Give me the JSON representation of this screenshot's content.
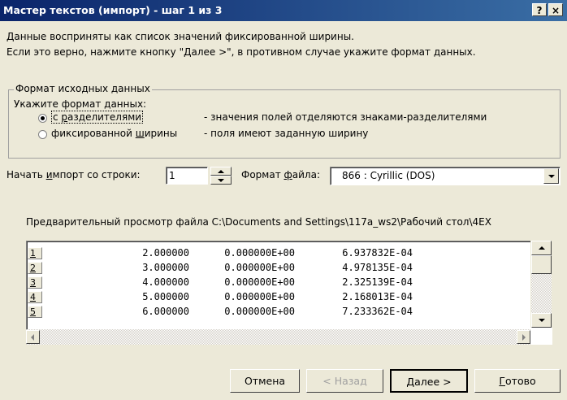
{
  "window": {
    "title": "Мастер текстов (импорт) - шаг 1 из 3",
    "help_label": "?",
    "close_label": "×"
  },
  "intro": {
    "line1": "Данные восприняты как список значений фиксированной ширины.",
    "line2": "Если это верно, нажмите кнопку \"Далее >\", в противном случае укажите формат данных."
  },
  "format_group": {
    "legend": "Формат исходных данных",
    "prompt": "Укажите формат данных:",
    "options": [
      {
        "pre": "с ",
        "key": "р",
        "post": "азделителями",
        "description": "- значения полей отделяются знаками-разделителями",
        "selected": true
      },
      {
        "pre": "фиксированной ",
        "key": "ш",
        "post": "ирины",
        "description": "- поля имеют заданную ширину",
        "selected": false
      }
    ]
  },
  "start_row": {
    "label_pre": "Начать ",
    "label_key": "и",
    "label_post": "мпорт со строки:",
    "value": "1"
  },
  "file_format": {
    "label_pre": "Формат ",
    "label_key": "ф",
    "label_post": "айла:",
    "value": "866 : Cyrillic (DOS)"
  },
  "preview": {
    "caption": "Предварительный просмотр файла C:\\Documents and Settings\\117a_ws2\\Рабочий стол\\4EX",
    "rows": [
      {
        "num": "1",
        "c1": "2.000000",
        "c2": "0.000000E+00",
        "c3": "6.937832E-04"
      },
      {
        "num": "2",
        "c1": "3.000000",
        "c2": "0.000000E+00",
        "c3": "4.978135E-04"
      },
      {
        "num": "3",
        "c1": "4.000000",
        "c2": "0.000000E+00",
        "c3": "2.325139E-04"
      },
      {
        "num": "4",
        "c1": "5.000000",
        "c2": "0.000000E+00",
        "c3": "2.168013E-04"
      },
      {
        "num": "5",
        "c1": "6.000000",
        "c2": "0.000000E+00",
        "c3": "7.233362E-04"
      }
    ]
  },
  "buttons": {
    "cancel": "Отмена",
    "back": "< Назад",
    "next_key": "Д",
    "next_post": "алее >",
    "finish_key": "Г",
    "finish_post": "отово"
  },
  "colors": {
    "title_gradient_start": "#0a246a",
    "title_gradient_end": "#3a6ea5",
    "dialog_bg": "#ece9d8",
    "disabled_text": "#a0a0a0"
  }
}
